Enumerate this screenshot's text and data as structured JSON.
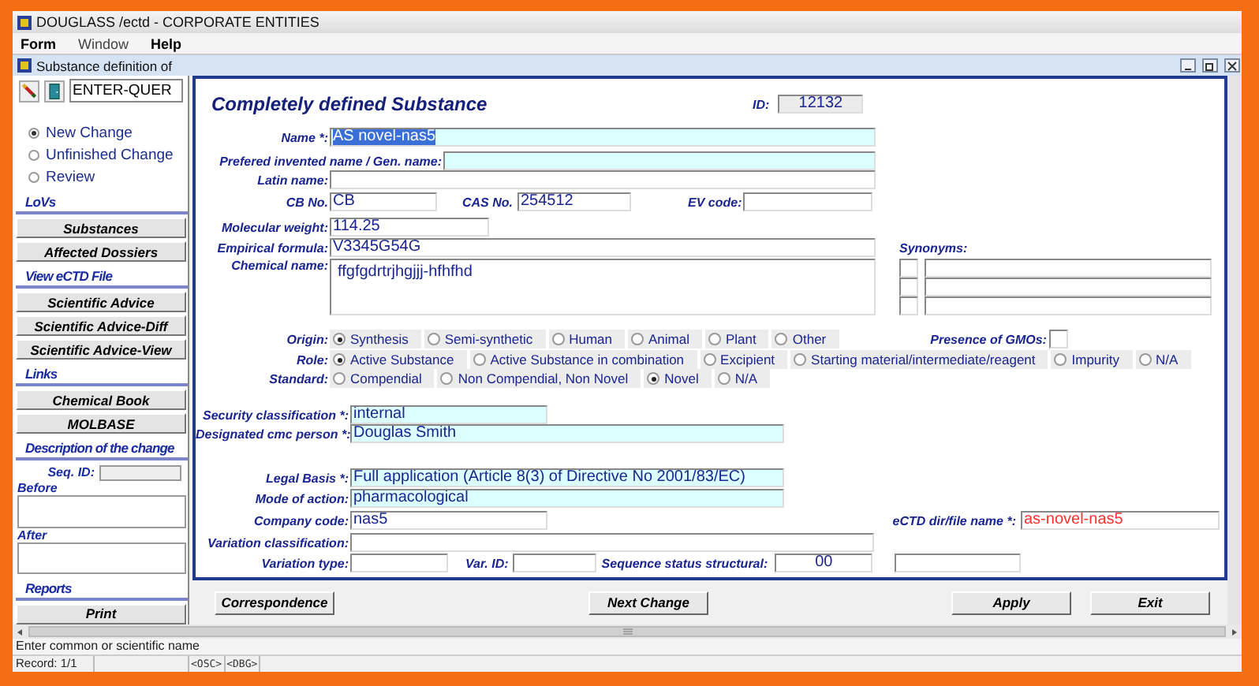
{
  "window": {
    "title": "DOUGLASS /ectd - CORPORATE ENTITIES"
  },
  "menu": [
    {
      "label": "Form",
      "disabled": false
    },
    {
      "label": "Window",
      "disabled": true
    },
    {
      "label": "Help",
      "disabled": false
    }
  ],
  "subwindow": {
    "title": "Substance definition of"
  },
  "sidebar": {
    "query_field": "ENTER-QUER",
    "modes": [
      {
        "label": "New Change",
        "selected": true
      },
      {
        "label": "Unfinished Change",
        "selected": false
      },
      {
        "label": "Review",
        "selected": false
      }
    ],
    "items": [
      {
        "kind": "heading",
        "label": "LoVs"
      },
      {
        "kind": "button",
        "label": "Substances"
      },
      {
        "kind": "button",
        "label": "Affected Dossiers"
      },
      {
        "kind": "heading",
        "label": "View eCTD File"
      },
      {
        "kind": "button",
        "label": "Scientific Advice"
      },
      {
        "kind": "button",
        "label": "Scientific Advice-Diff"
      },
      {
        "kind": "button",
        "label": "Scientific Advice-View"
      },
      {
        "kind": "heading",
        "label": "Links"
      },
      {
        "kind": "button",
        "label": "Chemical Book"
      },
      {
        "kind": "button",
        "label": "MOLBASE"
      },
      {
        "kind": "heading",
        "label": "Description of the change"
      },
      {
        "kind": "field",
        "label": "Seq. ID:"
      },
      {
        "kind": "memo",
        "label": "Before"
      },
      {
        "kind": "memo",
        "label": "After"
      },
      {
        "kind": "heading",
        "label": "Reports"
      },
      {
        "kind": "button",
        "label": "Print"
      }
    ]
  },
  "form": {
    "title": "Completely defined Substance",
    "id": {
      "label": "ID:",
      "value": "12132"
    },
    "name": {
      "label": "Name *:",
      "value": "AS novel-nas5",
      "required": true,
      "selected": true
    },
    "preferred_name": {
      "label": "Prefered invented name / Gen. name:",
      "required": true
    },
    "latin_name": {
      "label": "Latin name:"
    },
    "cb_no": {
      "label": "CB No.",
      "value": "CB"
    },
    "cas_no": {
      "label": "CAS No.",
      "value": "254512"
    },
    "ev_code": {
      "label": "EV code:"
    },
    "molecular_weight": {
      "label": "Molecular weight:",
      "value": "114.25"
    },
    "empirical_formula": {
      "label": "Empirical formula:",
      "value": "V3345G54G"
    },
    "chemical_name": {
      "label": "Chemical name:",
      "value": "ffgfgdrtrjhgjjj-hfhfhd"
    },
    "synonyms": {
      "label": "Synonyms:",
      "rows": [
        {
          "checked": false
        },
        {
          "checked": false
        },
        {
          "checked": false
        }
      ]
    },
    "origin": {
      "label": "Origin:",
      "options": [
        {
          "label": "Synthesis",
          "selected": true
        },
        {
          "label": "Semi-synthetic",
          "selected": false
        },
        {
          "label": "Human",
          "selected": false
        },
        {
          "label": "Animal",
          "selected": false
        },
        {
          "label": "Plant",
          "selected": false
        },
        {
          "label": "Other",
          "selected": false
        }
      ]
    },
    "gmo": {
      "label": "Presence of GMOs:",
      "checked": false
    },
    "role": {
      "label": "Role:",
      "options": [
        {
          "label": "Active Substance",
          "selected": true
        },
        {
          "label": "Active Substance in combination",
          "selected": false
        },
        {
          "label": "Excipient",
          "selected": false
        },
        {
          "label": "Starting material/intermediate/reagent",
          "selected": false
        },
        {
          "label": "Impurity",
          "selected": false
        },
        {
          "label": "N/A",
          "selected": false
        }
      ]
    },
    "standard": {
      "label": "Standard:",
      "options": [
        {
          "label": "Compendial",
          "selected": false
        },
        {
          "label": "Non Compendial, Non Novel",
          "selected": false
        },
        {
          "label": "Novel",
          "selected": true
        },
        {
          "label": "N/A",
          "selected": false
        }
      ]
    },
    "security_classification": {
      "label": "Security classification *:",
      "value": "internal",
      "required": true
    },
    "cmc_person": {
      "label": "Designated cmc person *:",
      "value": "Douglas Smith",
      "required": true
    },
    "legal_basis": {
      "label": "Legal Basis *:",
      "value": "Full application (Article 8(3) of Directive No 2001/83/EC)",
      "required": true
    },
    "mode_of_action": {
      "label": "Mode of action:",
      "value": "pharmacological",
      "required": true
    },
    "company_code": {
      "label": "Company code:",
      "value": "nas5"
    },
    "ectd_file_name": {
      "label": "eCTD dir/file name *:",
      "value": "as-novel-nas5",
      "error": true
    },
    "variation_classification": {
      "label": "Variation classification:"
    },
    "variation_type": {
      "label": "Variation type:"
    },
    "var_id": {
      "label": "Var. ID:"
    },
    "sequence_status": {
      "label": "Sequence status structural:",
      "value": "00"
    }
  },
  "buttons": [
    {
      "label": "Correspondence"
    },
    {
      "label": "Next Change"
    },
    {
      "label": "Apply"
    },
    {
      "label": "Exit"
    }
  ],
  "status": {
    "hint": "Enter common or scientific name",
    "record": "Record: 1/1",
    "indicators": [
      "<OSC>",
      "<DBG>"
    ]
  }
}
